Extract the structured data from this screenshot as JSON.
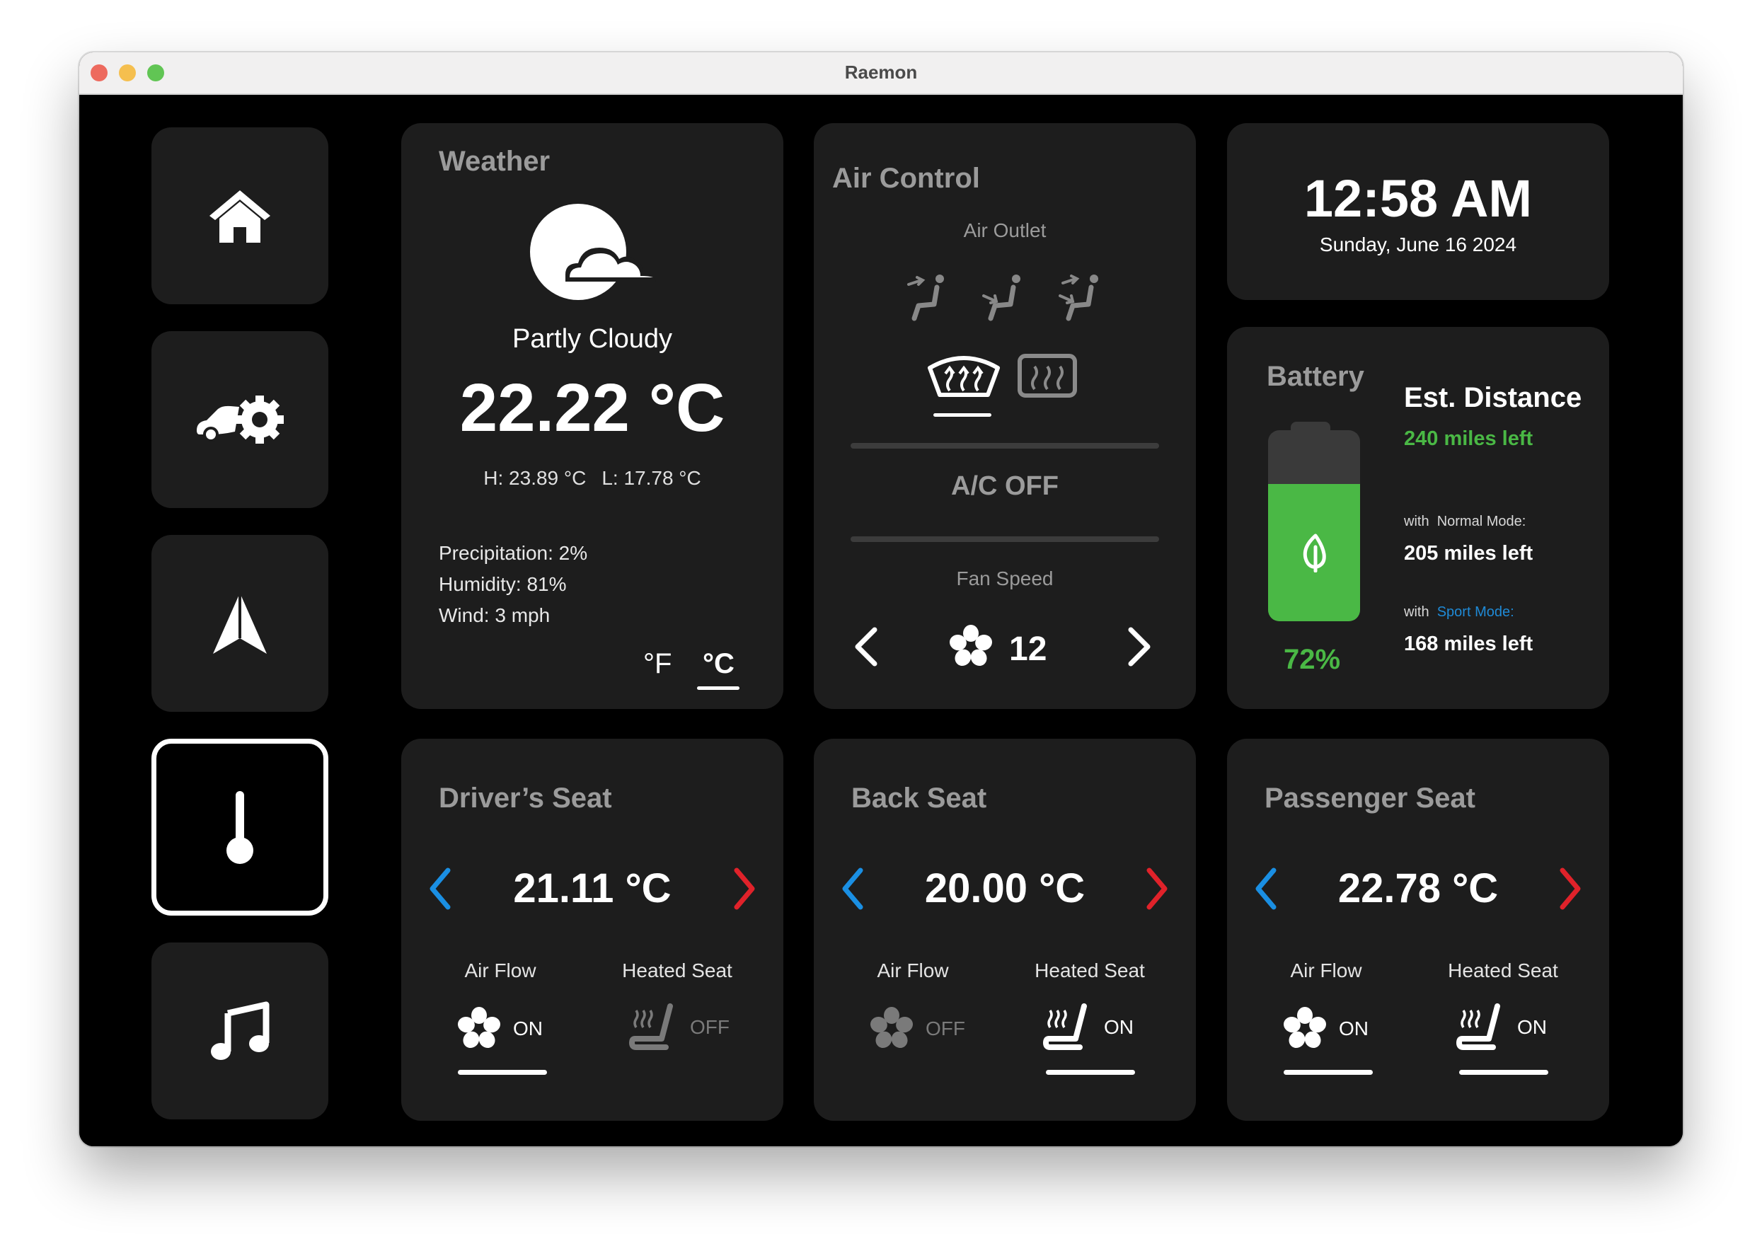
{
  "window": {
    "title": "Raemon"
  },
  "nav": {
    "items": [
      {
        "id": "home",
        "icon": "home-icon",
        "active": false
      },
      {
        "id": "car-settings",
        "icon": "car-gear-icon",
        "active": false
      },
      {
        "id": "navigation",
        "icon": "navigation-arrow-icon",
        "active": false
      },
      {
        "id": "climate",
        "icon": "thermometer-icon",
        "active": true
      },
      {
        "id": "music",
        "icon": "music-note-icon",
        "active": false
      }
    ]
  },
  "weather": {
    "title": "Weather",
    "icon": "partly-cloudy-icon",
    "condition": "Partly Cloudy",
    "temperature": "22.22 °C",
    "high": "H: 23.89 °C",
    "low": "L: 17.78 °C",
    "precipitation": "Precipitation: 2%",
    "humidity": "Humidity: 81%",
    "wind": "Wind: 3 mph",
    "unit_f": "°F",
    "unit_c": "°C",
    "selected_unit": "°C"
  },
  "air_control": {
    "title": "Air Control",
    "outlet_label": "Air Outlet",
    "outlet_icons": [
      "air-outlet-face-icon",
      "air-outlet-feet-icon",
      "air-outlet-face-feet-icon"
    ],
    "defrost_icons": [
      "front-defrost-icon",
      "rear-defrost-icon"
    ],
    "ac_status": "A/C OFF",
    "fan_label": "Fan Speed",
    "fan_speed": "12"
  },
  "clock": {
    "time": "12:58 AM",
    "date": "Sunday, June 16 2024"
  },
  "battery": {
    "title": "Battery",
    "level": 0.72,
    "percent": "72%",
    "est_title": "Est. Distance",
    "est_value": "240 miles left",
    "normal_prefix": "with",
    "normal_mode": "Normal Mode:",
    "normal_value": "205 miles left",
    "sport_prefix": "with",
    "sport_mode": "Sport Mode:",
    "sport_value": "168 miles left",
    "colors": {
      "green": "#4ab845",
      "sport": "#1f8ad6"
    }
  },
  "seats": {
    "driver": {
      "title": "Driver’s Seat",
      "temp": "21.11 °C",
      "airflow_label": "Air Flow",
      "airflow_state": "ON",
      "heated_label": "Heated Seat",
      "heated_state": "OFF"
    },
    "back": {
      "title": "Back Seat",
      "temp": "20.00 °C",
      "airflow_label": "Air Flow",
      "airflow_state": "OFF",
      "heated_label": "Heated Seat",
      "heated_state": "ON"
    },
    "passenger": {
      "title": "Passenger Seat",
      "temp": "22.78 °C",
      "airflow_label": "Air Flow",
      "airflow_state": "ON",
      "heated_label": "Heated Seat",
      "heated_state": "ON"
    }
  },
  "colors": {
    "decrease_arrow": "#1a8fe3",
    "increase_arrow": "#e0222a",
    "card_bg": "#1d1d1d"
  }
}
